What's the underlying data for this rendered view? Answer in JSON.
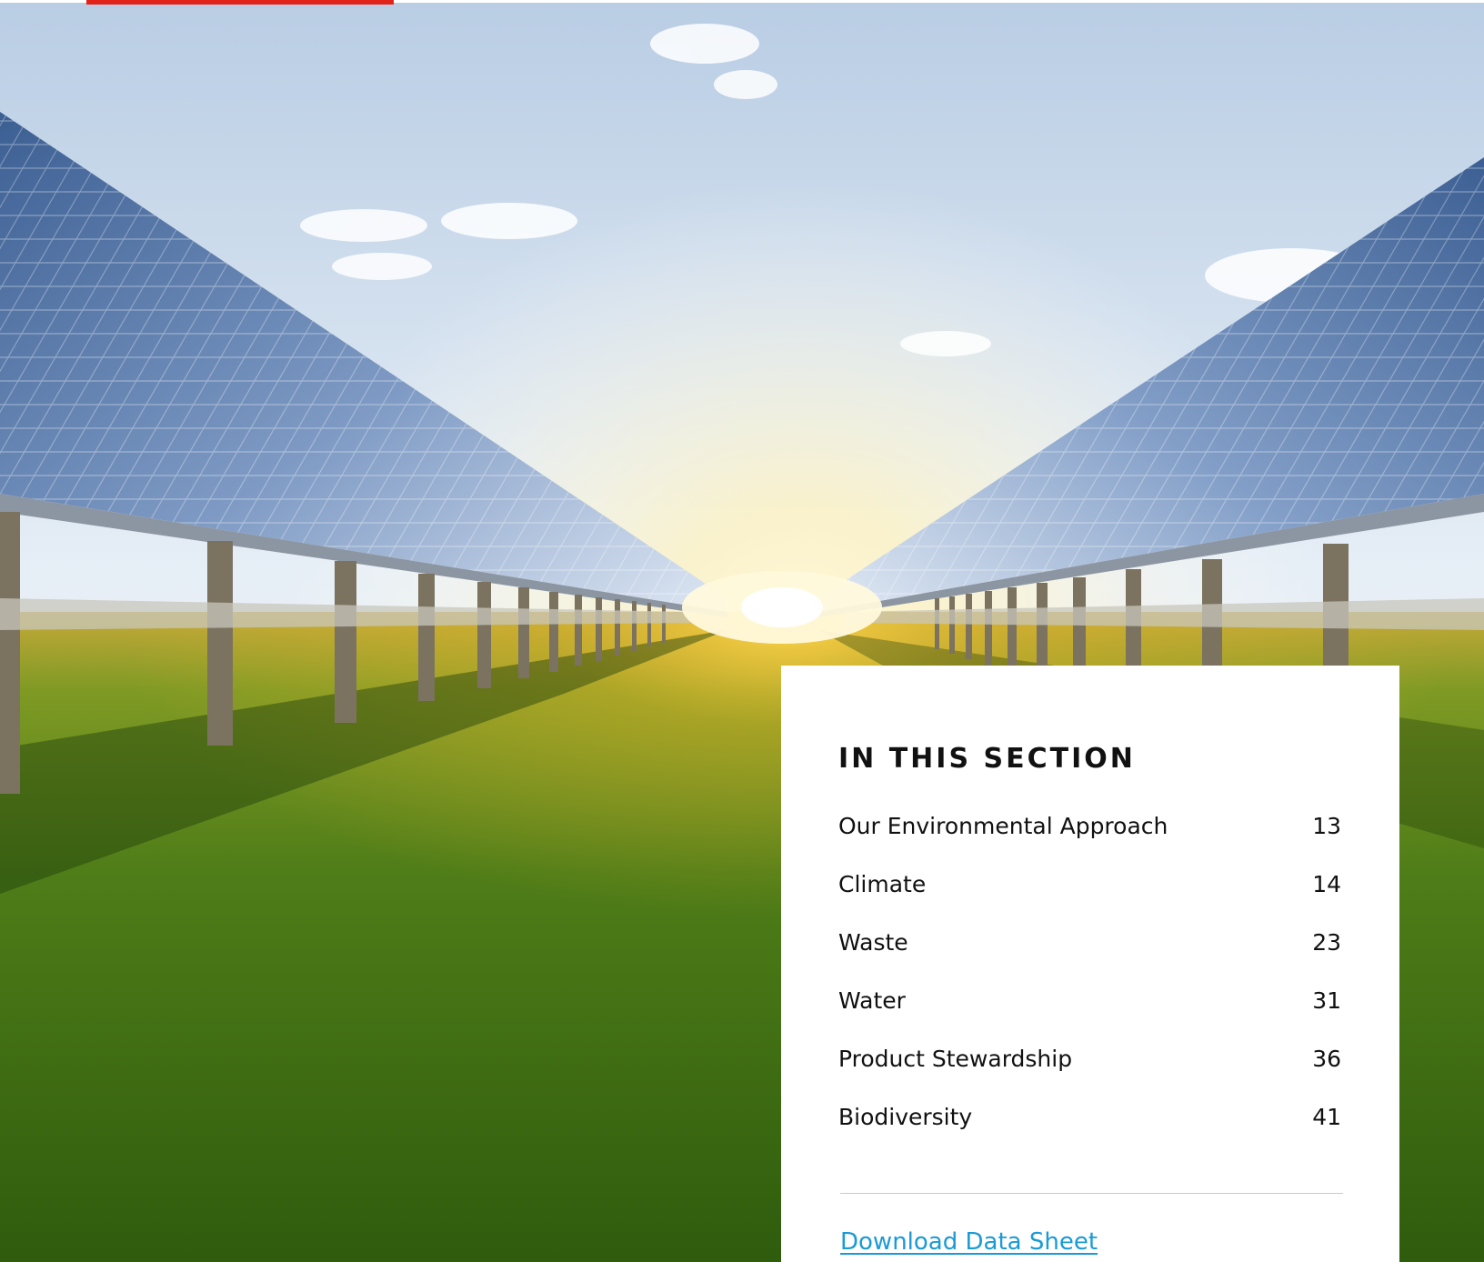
{
  "colors": {
    "accent_bar": "#e2231a",
    "heading_text": "#111111",
    "link": "#1a9ad6",
    "divider": "#c9c9c9",
    "card_background": "#ffffff"
  },
  "hero": {
    "image_subject": "solar-panel-field-sunrise"
  },
  "toc": {
    "heading": "IN THIS SECTION",
    "items": [
      {
        "label": "Our Environmental Approach",
        "page": "13"
      },
      {
        "label": "Climate",
        "page": "14"
      },
      {
        "label": "Waste",
        "page": "23"
      },
      {
        "label": "Water",
        "page": "31"
      },
      {
        "label": "Product Stewardship",
        "page": "36"
      },
      {
        "label": "Biodiversity",
        "page": "41"
      }
    ],
    "download_label": "Download Data Sheet"
  }
}
